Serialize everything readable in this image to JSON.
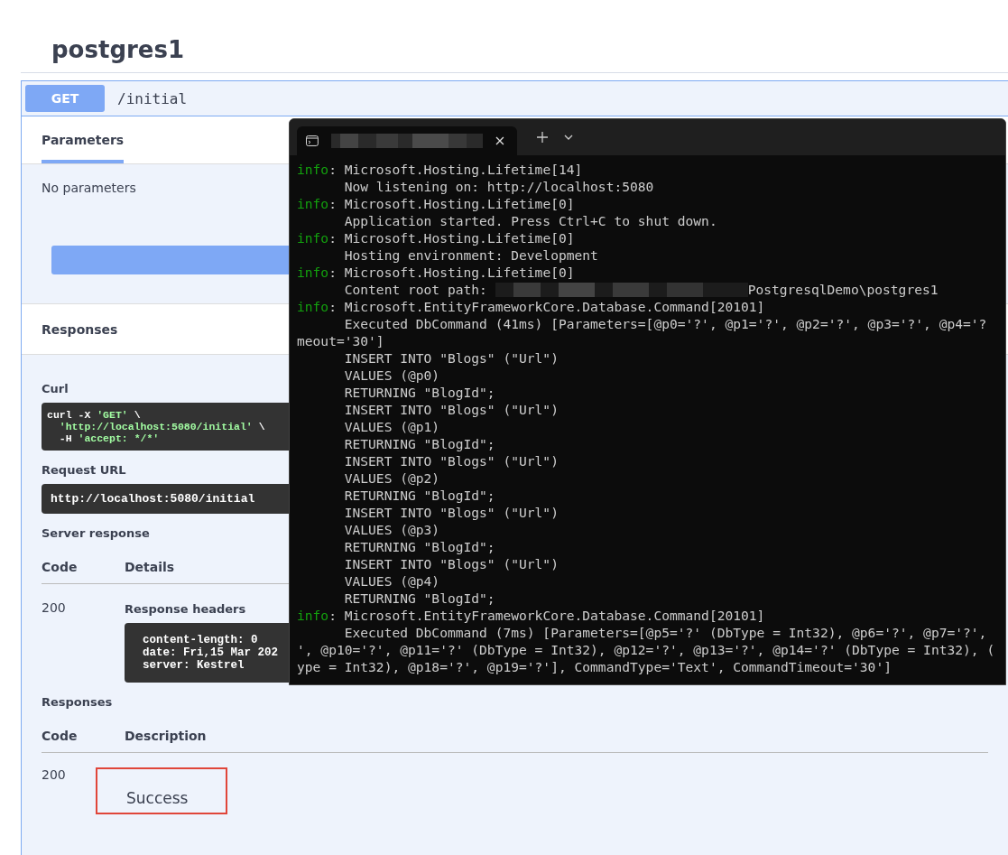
{
  "page_title": "postgres1",
  "operation": {
    "method": "GET",
    "path": "/initial"
  },
  "tabs": [
    {
      "label": "Parameters",
      "selected": true
    }
  ],
  "no_parameters": "No parameters",
  "responses_header": "Responses",
  "curl": {
    "label": "Curl",
    "lines": [
      {
        "text": "curl -X ",
        "str": "'GET'",
        "tail": " \\"
      },
      {
        "str": "'http://localhost:5080/initial'",
        "tail": " \\"
      },
      {
        "text": "-H ",
        "str": "'accept: */*'"
      }
    ]
  },
  "request_url": {
    "label": "Request URL",
    "value": "http://localhost:5080/initial"
  },
  "server_response": {
    "label": "Server response",
    "code_heading": "Code",
    "details_heading": "Details",
    "code": "200",
    "headers_label": "Response headers",
    "headers": [
      "content-length: 0",
      "date: Fri,15 Mar 202",
      "server: Kestrel"
    ]
  },
  "responses": {
    "label": "Responses",
    "code_heading": "Code",
    "description_heading": "Description",
    "rows": [
      {
        "code": "200",
        "description": "Success",
        "highlighted": true
      }
    ]
  },
  "terminal": {
    "tab_title_redacted": true,
    "lines": [
      {
        "kind": "info",
        "level": "info",
        "text": ": Microsoft.Hosting.Lifetime[14]"
      },
      {
        "kind": "plain",
        "text": "      Now listening on: http://localhost:5080"
      },
      {
        "kind": "info",
        "level": "info",
        "text": ": Microsoft.Hosting.Lifetime[0]"
      },
      {
        "kind": "plain",
        "text": "      Application started. Press Ctrl+C to shut down."
      },
      {
        "kind": "info",
        "level": "info",
        "text": ": Microsoft.Hosting.Lifetime[0]"
      },
      {
        "kind": "plain",
        "text": "      Hosting environment: Development"
      },
      {
        "kind": "info",
        "level": "info",
        "text": ": Microsoft.Hosting.Lifetime[0]"
      },
      {
        "kind": "redacted",
        "text": "      Content root path: ",
        "suffix": "PostgresqlDemo\\postgres1"
      },
      {
        "kind": "info",
        "level": "info",
        "text": ": Microsoft.EntityFrameworkCore.Database.Command[20101]"
      },
      {
        "kind": "plain",
        "text": "      Executed DbCommand (41ms) [Parameters=[@p0='?', @p1='?', @p2='?', @p3='?', @p4='?"
      },
      {
        "kind": "plain",
        "text": "meout='30']"
      },
      {
        "kind": "plain",
        "text": "      INSERT INTO \"Blogs\" (\"Url\")"
      },
      {
        "kind": "plain",
        "text": "      VALUES (@p0)"
      },
      {
        "kind": "plain",
        "text": "      RETURNING \"BlogId\";"
      },
      {
        "kind": "plain",
        "text": "      INSERT INTO \"Blogs\" (\"Url\")"
      },
      {
        "kind": "plain",
        "text": "      VALUES (@p1)"
      },
      {
        "kind": "plain",
        "text": "      RETURNING \"BlogId\";"
      },
      {
        "kind": "plain",
        "text": "      INSERT INTO \"Blogs\" (\"Url\")"
      },
      {
        "kind": "plain",
        "text": "      VALUES (@p2)"
      },
      {
        "kind": "plain",
        "text": "      RETURNING \"BlogId\";"
      },
      {
        "kind": "plain",
        "text": "      INSERT INTO \"Blogs\" (\"Url\")"
      },
      {
        "kind": "plain",
        "text": "      VALUES (@p3)"
      },
      {
        "kind": "plain",
        "text": "      RETURNING \"BlogId\";"
      },
      {
        "kind": "plain",
        "text": "      INSERT INTO \"Blogs\" (\"Url\")"
      },
      {
        "kind": "plain",
        "text": "      VALUES (@p4)"
      },
      {
        "kind": "plain",
        "text": "      RETURNING \"BlogId\";"
      },
      {
        "kind": "info",
        "level": "info",
        "text": ": Microsoft.EntityFrameworkCore.Database.Command[20101]"
      },
      {
        "kind": "plain",
        "text": "      Executed DbCommand (7ms) [Parameters=[@p5='?' (DbType = Int32), @p6='?', @p7='?',"
      },
      {
        "kind": "plain",
        "text": "', @p10='?', @p11='?' (DbType = Int32), @p12='?', @p13='?', @p14='?' (DbType = Int32), ("
      },
      {
        "kind": "plain",
        "text": "ype = Int32), @p18='?', @p19='?'], CommandType='Text', CommandTimeout='30']"
      }
    ]
  }
}
